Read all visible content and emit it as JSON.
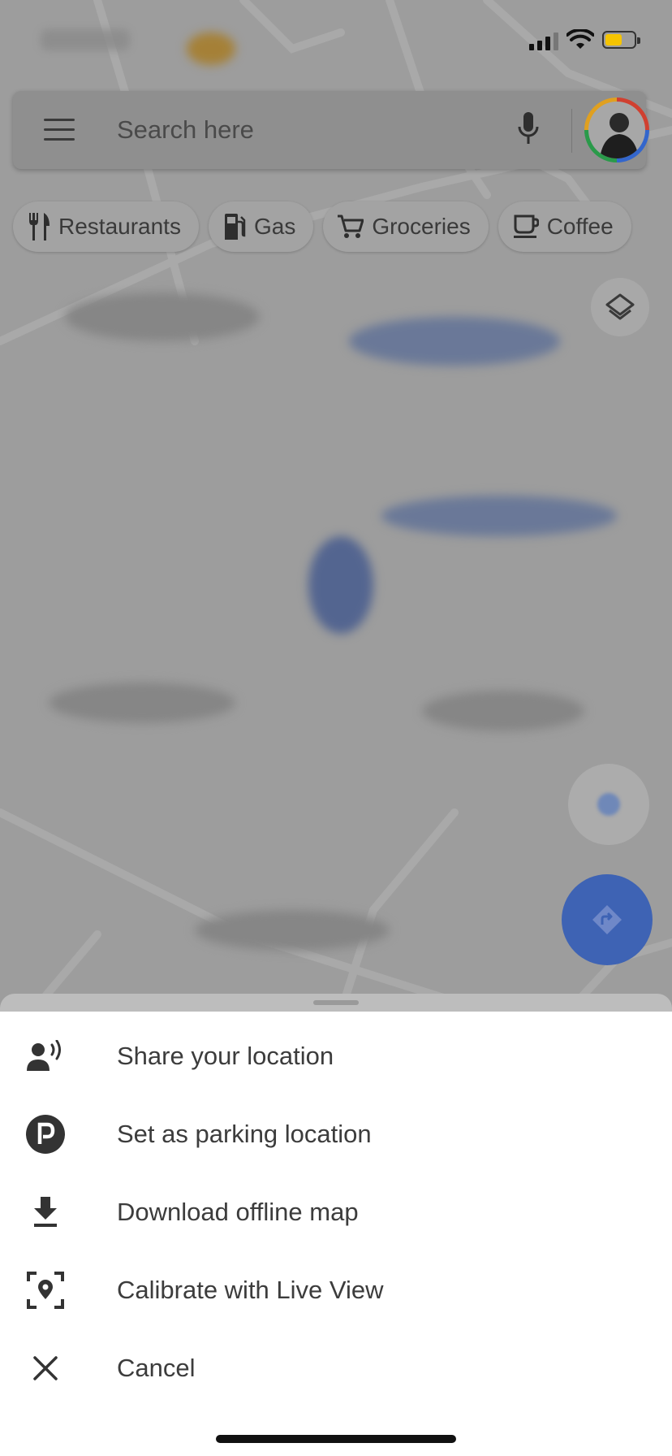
{
  "search": {
    "placeholder": "Search here"
  },
  "chips": [
    {
      "label": "Restaurants",
      "icon": "fork-knife-icon"
    },
    {
      "label": "Gas",
      "icon": "gas-pump-icon"
    },
    {
      "label": "Groceries",
      "icon": "shopping-cart-icon"
    },
    {
      "label": "Coffee",
      "icon": "coffee-cup-icon"
    }
  ],
  "menu": {
    "items": [
      {
        "label": "Share your location",
        "icon": "share-location-icon"
      },
      {
        "label": "Set as parking location",
        "icon": "parking-icon"
      },
      {
        "label": "Download offline map",
        "icon": "download-icon"
      },
      {
        "label": "Calibrate with Live View",
        "icon": "live-view-icon"
      },
      {
        "label": "Cancel",
        "icon": "close-icon"
      }
    ]
  },
  "colors": {
    "sheet_background": "#ffffff",
    "directions_button": "#3e63b4",
    "battery": "#f5c400"
  }
}
